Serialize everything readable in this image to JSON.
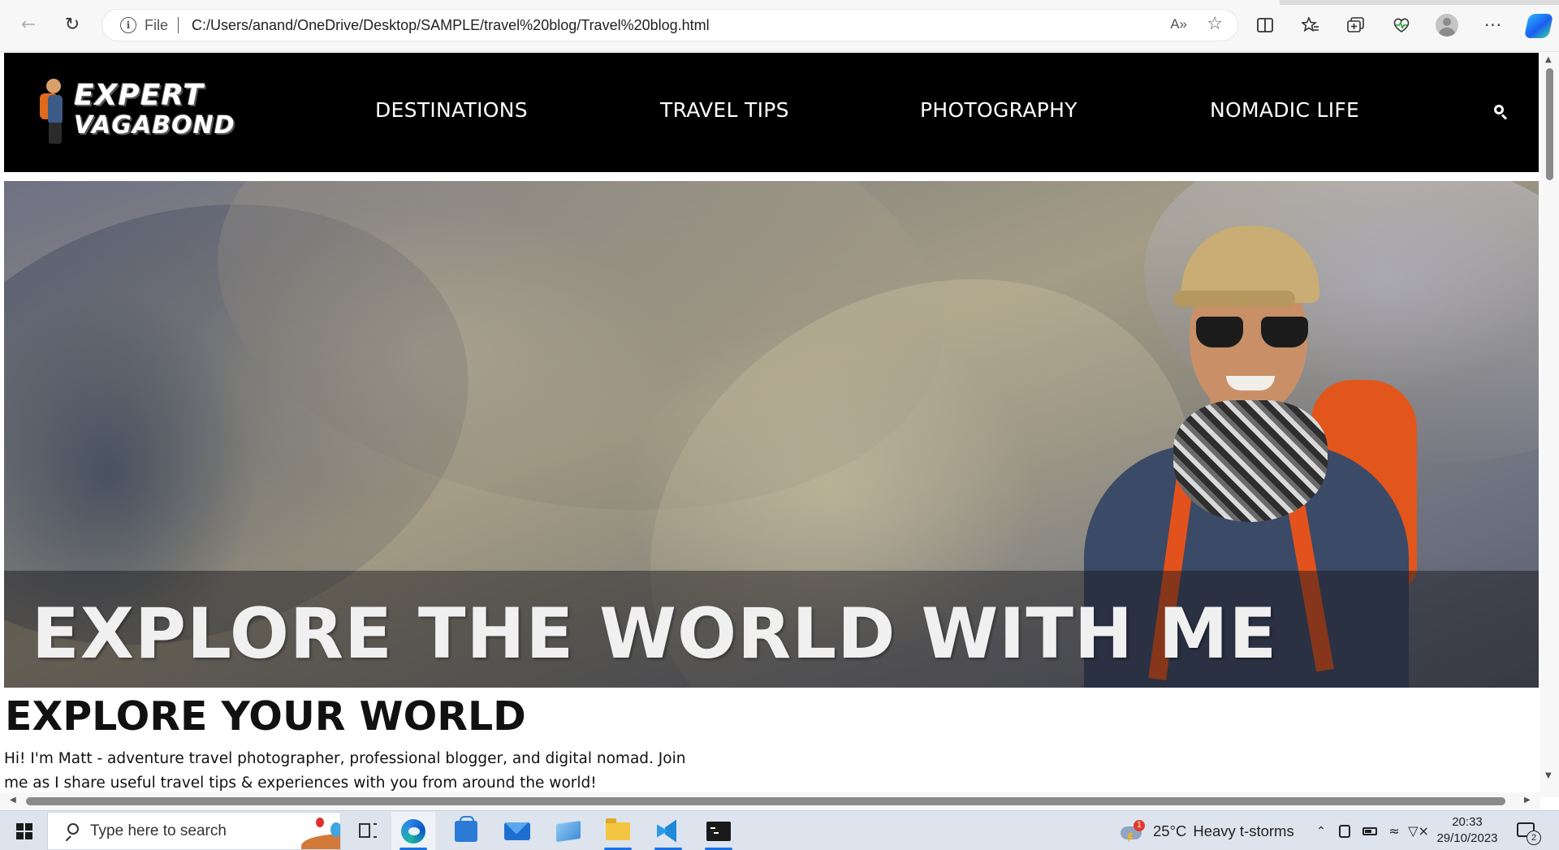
{
  "browser": {
    "file_label": "File",
    "url": "C:/Users/anand/OneDrive/Desktop/SAMPLE/travel%20blog/Travel%20blog.html",
    "read_aloud_label": "A»"
  },
  "site": {
    "logo": {
      "line1": "EXPERT",
      "line2": "VAGABOND"
    },
    "nav": [
      {
        "label": "DESTINATIONS"
      },
      {
        "label": "TRAVEL TIPS"
      },
      {
        "label": "PHOTOGRAPHY"
      },
      {
        "label": "NOMADIC LIFE"
      }
    ],
    "hero": {
      "title": "EXPLORE THE WORLD WITH ME"
    },
    "section": {
      "heading": "EXPLORE YOUR WORLD",
      "intro": "Hi! I'm Matt - adventure travel photographer, professional blogger, and digital nomad. Join me as I share useful travel tips & experiences with you from around the world!"
    }
  },
  "taskbar": {
    "search_placeholder": "Type here to search",
    "weather": {
      "temperature": "25°C",
      "condition": "Heavy t-storms",
      "alert_count": "1"
    },
    "clock": {
      "time": "20:33",
      "date": "29/10/2023"
    },
    "notifications_count": "2"
  },
  "icons": {
    "back": "arrow-left-icon",
    "reload": "reload-icon",
    "info": "info-icon",
    "favorite": "star-icon",
    "split_screen": "split-screen-icon",
    "favorites_list": "favorites-icon",
    "collections": "collections-icon",
    "browser_essentials": "heart-pulse-icon",
    "more": "more-icon",
    "search": "search-icon"
  }
}
